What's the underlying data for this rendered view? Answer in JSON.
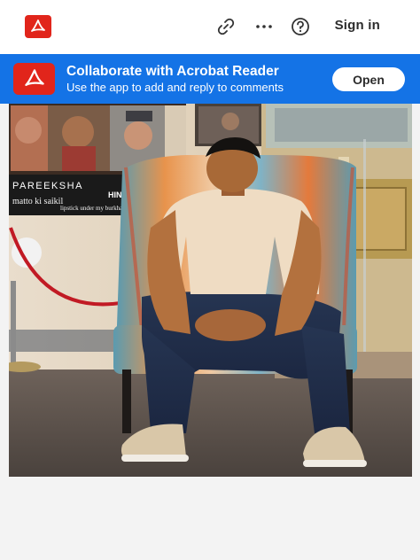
{
  "topbar": {
    "app_icon": "acrobat-icon",
    "link_icon": "link-icon",
    "more_icon": "more-horizontal-icon",
    "help_icon": "help-icon",
    "signin_label": "Sign in"
  },
  "banner": {
    "icon": "acrobat-icon",
    "title": "Collaborate with Acrobat Reader",
    "subtitle": "Use the app to add and reply to comments",
    "open_label": "Open",
    "background": "#1473e6"
  },
  "document": {
    "image": "photo",
    "poster_text": {
      "pareeksha": "PAREEKSHA",
      "matto": "matto ki saikil",
      "lipstick": "lipstick under my burkha",
      "hindi": "HIN HIP HUR"
    }
  },
  "colors": {
    "acrobat_red": "#e1251b",
    "accent_blue": "#1473e6"
  }
}
